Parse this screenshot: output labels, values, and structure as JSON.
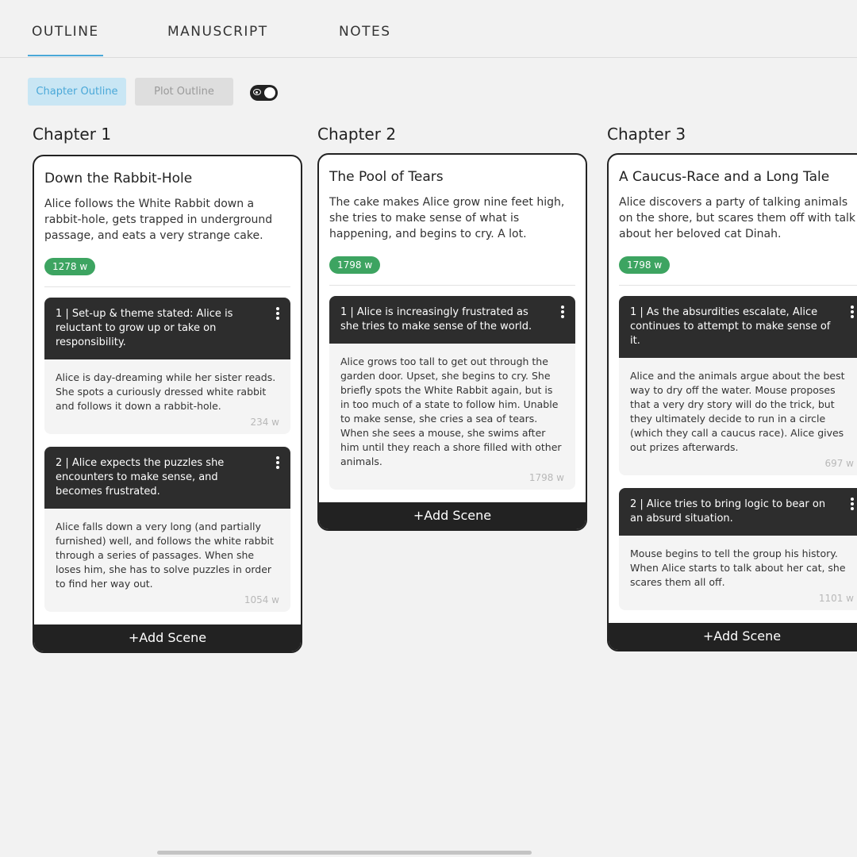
{
  "tabs": [
    {
      "label": "OUTLINE",
      "active": true
    },
    {
      "label": "MANUSCRIPT",
      "active": false
    },
    {
      "label": "NOTES",
      "active": false
    }
  ],
  "toolbar": {
    "chapter_outline_label": "Chapter Outline",
    "plot_outline_label": "Plot Outline",
    "visibility_toggle_icon": "eye-icon"
  },
  "chapters": [
    {
      "heading": "Chapter 1",
      "title": "Down the Rabbit-Hole",
      "summary": "Alice follows the White Rabbit down a rabbit-hole, gets trapped in underground passage, and eats a very strange cake.",
      "word_count": "1278 w",
      "scenes": [
        {
          "head": "1 | Set-up & theme stated: Alice is reluctant to grow up or take on responsibility.",
          "desc": "Alice is day-dreaming while her sister reads. She spots a curiously dressed white rabbit and follows it down a rabbit-hole.",
          "wc": "234 w"
        },
        {
          "head": "2 | Alice expects the puzzles she encounters to make sense, and becomes frustrated.",
          "desc": "Alice falls down a very long (and partially furnished) well, and follows the white rabbit through a series of passages. When she loses him, she has to solve puzzles in order to find her way out.",
          "wc": "1054 w"
        }
      ],
      "add_scene": "+Add Scene"
    },
    {
      "heading": "Chapter 2",
      "title": "The Pool of Tears",
      "summary": "The cake makes Alice grow nine feet high, she tries to make sense of what is happening, and begins to cry. A lot.",
      "word_count": "1798 w",
      "scenes": [
        {
          "head": "1 | Alice is increasingly frustrated as she tries to make sense of the world.",
          "desc": "Alice grows too tall to get out through the garden door. Upset, she begins to cry. She briefly spots the White Rabbit again, but is in too much of a state to follow him. Unable to make sense, she cries a sea of tears. When she sees a mouse, she swims after him until they reach a shore filled with other animals.",
          "wc": "1798 w"
        }
      ],
      "add_scene": "+Add Scene"
    },
    {
      "heading": "Chapter 3",
      "title": "A Caucus-Race and a Long Tale",
      "summary": "Alice discovers a party of talking animals on the shore, but scares them off with talk about her beloved cat Dinah.",
      "word_count": "1798 w",
      "scenes": [
        {
          "head": "1 | As the absurdities escalate, Alice continues to attempt to make sense of it.",
          "desc": "Alice and the animals argue about the best way to dry off the water. Mouse proposes that a very dry story will do the trick, but they ultimately decide to run in a circle (which they call a caucus race). Alice gives out prizes afterwards.",
          "wc": "697 w"
        },
        {
          "head": "2 | Alice tries to bring logic to bear on an absurd situation.",
          "desc": "Mouse begins to tell the group his history. When Alice starts to talk about her cat, she scares them all off.",
          "wc": "1101 w"
        }
      ],
      "add_scene": "+Add Scene"
    }
  ],
  "colors": {
    "accent": "#4aa8d8",
    "badge_green": "#3da461",
    "dark": "#2d2d2d"
  }
}
